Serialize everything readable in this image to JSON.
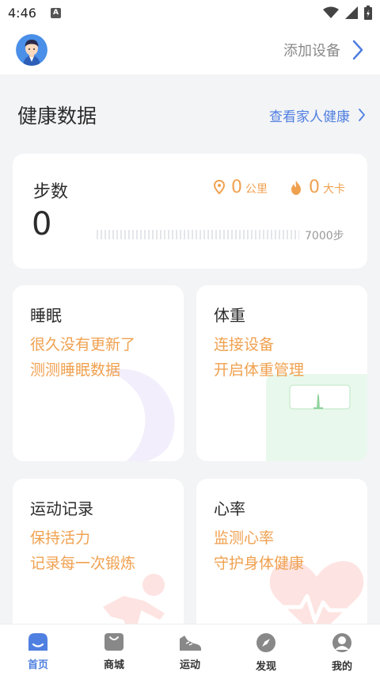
{
  "status_bar": {
    "time": "4:46",
    "notif_badge": "A"
  },
  "header": {
    "add_device_label": "添加设备"
  },
  "section": {
    "title": "健康数据",
    "family_link": "查看家人健康"
  },
  "steps_card": {
    "title": "步数",
    "value": "0",
    "distance_value": "0",
    "distance_unit": "公里",
    "calories_value": "0",
    "calories_unit": "大卡",
    "goal_label": "7000步",
    "progress": 0
  },
  "sleep_card": {
    "title": "睡眠",
    "line1": "很久没有更新了",
    "line2": "测测睡眠数据"
  },
  "weight_card": {
    "title": "体重",
    "line1": "连接设备",
    "line2": "开启体重管理"
  },
  "sport_card": {
    "title": "运动记录",
    "line1": "保持活力",
    "line2": "记录每一次锻炼"
  },
  "heart_card": {
    "title": "心率",
    "line1": "监测心率",
    "line2": "守护身体健康"
  },
  "nav": {
    "items": [
      {
        "label": "首页",
        "icon": "home-icon",
        "active": true
      },
      {
        "label": "商城",
        "icon": "shopping-bag-icon",
        "active": false
      },
      {
        "label": "运动",
        "icon": "sneaker-icon",
        "active": false
      },
      {
        "label": "发现",
        "icon": "compass-icon",
        "active": false
      },
      {
        "label": "我的",
        "icon": "profile-icon",
        "active": false
      }
    ]
  },
  "colors": {
    "accent_blue": "#4f7fe0",
    "accent_orange": "#f0a150",
    "background": "#f3f4f6"
  }
}
